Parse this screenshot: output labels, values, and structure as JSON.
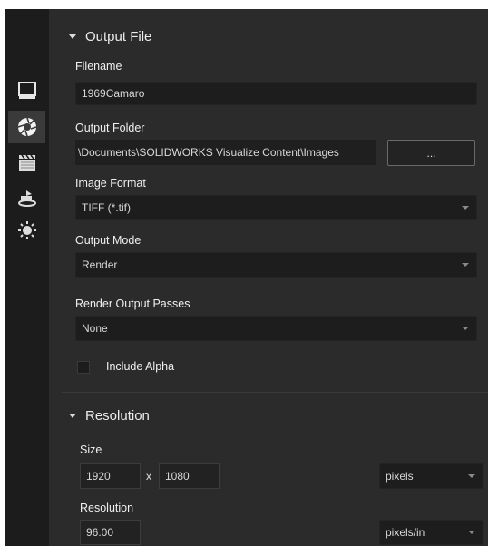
{
  "rail": {
    "items": [
      {
        "name": "image-settings-icon"
      },
      {
        "name": "camera-aperture-icon"
      },
      {
        "name": "clapperboard-icon"
      },
      {
        "name": "teapot-render-icon"
      },
      {
        "name": "sun-icon"
      }
    ]
  },
  "output_file": {
    "title": "Output File",
    "filename_label": "Filename",
    "filename_value": "1969Camaro",
    "folder_label": "Output Folder",
    "folder_value": "\\Documents\\SOLIDWORKS Visualize Content\\Images",
    "browse_label": "...",
    "format_label": "Image Format",
    "format_value": "TIFF (*.tif)",
    "mode_label": "Output Mode",
    "mode_value": "Render",
    "passes_label": "Render Output Passes",
    "passes_value": "None",
    "alpha_label": "Include Alpha"
  },
  "resolution": {
    "title": "Resolution",
    "size_label": "Size",
    "width": "1920",
    "x_sep": "x",
    "height": "1080",
    "size_unit": "pixels",
    "resolution_label": "Resolution",
    "resolution_value": "96.00",
    "resolution_unit": "pixels/in"
  }
}
